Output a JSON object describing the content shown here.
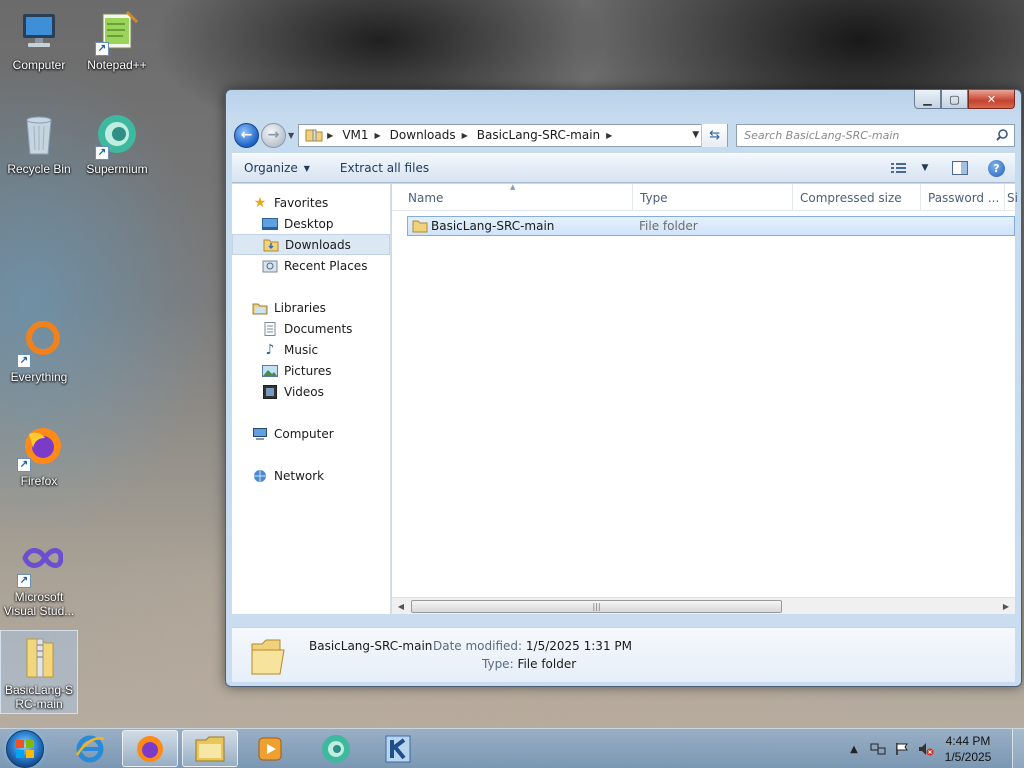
{
  "desktop": {
    "icons": [
      {
        "label": "Computer"
      },
      {
        "label": "Notepad++"
      },
      {
        "label": "Recycle Bin"
      },
      {
        "label": "Supermium"
      },
      {
        "label": "Everything"
      },
      {
        "label": "Firefox"
      },
      {
        "label": "Microsoft Visual Stud..."
      },
      {
        "label": "BasicLang-SRC-main"
      }
    ]
  },
  "window": {
    "breadcrumb": [
      "VM1",
      "Downloads",
      "BasicLang-SRC-main"
    ],
    "search_placeholder": "Search BasicLang-SRC-main",
    "toolbar": {
      "organize": "Organize",
      "extract": "Extract all files"
    },
    "nav": {
      "favorites": "Favorites",
      "desktop": "Desktop",
      "downloads": "Downloads",
      "recent": "Recent Places",
      "libraries": "Libraries",
      "documents": "Documents",
      "music": "Music",
      "pictures": "Pictures",
      "videos": "Videos",
      "computer": "Computer",
      "network": "Network"
    },
    "columns": [
      "Name",
      "Type",
      "Compressed size",
      "Password ...",
      "Si"
    ],
    "rows": [
      {
        "name": "BasicLang-SRC-main",
        "type": "File folder"
      }
    ],
    "details": {
      "name": "BasicLang-SRC-main",
      "date_label": "Date modified:",
      "date_value": "1/5/2025 1:31 PM",
      "type_label": "Type:",
      "type_value": "File folder"
    }
  },
  "taskbar": {
    "time": "4:44 PM",
    "date": "1/5/2025"
  }
}
